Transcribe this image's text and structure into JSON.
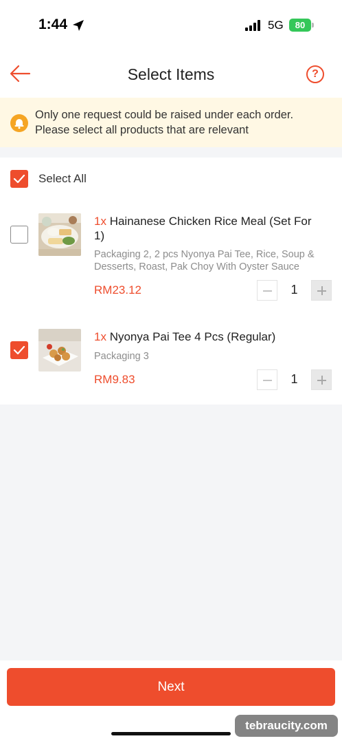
{
  "status_bar": {
    "time": "1:44",
    "network": "5G",
    "battery": "80"
  },
  "header": {
    "title": "Select Items"
  },
  "notice": {
    "text_line1": "Only one request could be raised under each order.",
    "text_line2": "Please select all products that are relevant"
  },
  "select_all": {
    "label": "Select All",
    "checked": true
  },
  "items": [
    {
      "checked": false,
      "qty_prefix": "1x",
      "name": "Hainanese Chicken Rice Meal (Set For 1)",
      "description": "Packaging 2, 2 pcs Nyonya Pai Tee, Rice, Soup & Desserts, Roast, Pak Choy With Oyster Sauce",
      "price": "RM23.12",
      "quantity": "1"
    },
    {
      "checked": true,
      "qty_prefix": "1x",
      "name": "Nyonya Pai Tee 4 Pcs (Regular)",
      "description": "Packaging 3",
      "price": "RM9.83",
      "quantity": "1"
    }
  ],
  "footer": {
    "next_label": "Next"
  },
  "watermark": {
    "text": "tebraucity.com"
  },
  "colors": {
    "accent": "#ee4d2d",
    "notice_bg": "#fff8e4",
    "bell": "#f5a524",
    "battery": "#34c759"
  },
  "icons": [
    "location-arrow-icon",
    "signal-icon",
    "battery-icon",
    "back-arrow-icon",
    "help-icon",
    "bell-icon",
    "checkmark-icon",
    "minus-icon",
    "plus-icon"
  ]
}
